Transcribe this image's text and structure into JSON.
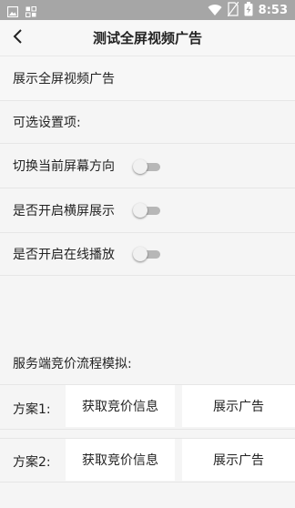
{
  "status_bar": {
    "time": "8:53",
    "icons": [
      "image-icon",
      "notification-icon",
      "wifi-icon",
      "no-sim-icon",
      "battery-charging-icon"
    ]
  },
  "header": {
    "title": "测试全屏视频广告",
    "back_icon": "chevron-left-icon"
  },
  "main": {
    "show_ad_label": "展示全屏视频广告",
    "optional_settings_label": "可选设置项:",
    "toggles": [
      {
        "label": "切换当前屏幕方向",
        "checked": false
      },
      {
        "label": "是否开启横屏展示",
        "checked": false
      },
      {
        "label": "是否开启在线播放",
        "checked": false
      }
    ],
    "server_bidding_label": "服务端竞价流程模拟:",
    "plans": [
      {
        "label": "方案1:",
        "bid_button": "获取竞价信息",
        "show_button": "展示广告"
      },
      {
        "label": "方案2:",
        "bid_button": "获取竞价信息",
        "show_button": "展示广告"
      }
    ]
  },
  "colors": {
    "background": "#f5f5f5",
    "status_bar": "#a6a6a6",
    "divider": "#e6e6e6",
    "toggle_track_off": "#b7b7b7"
  }
}
